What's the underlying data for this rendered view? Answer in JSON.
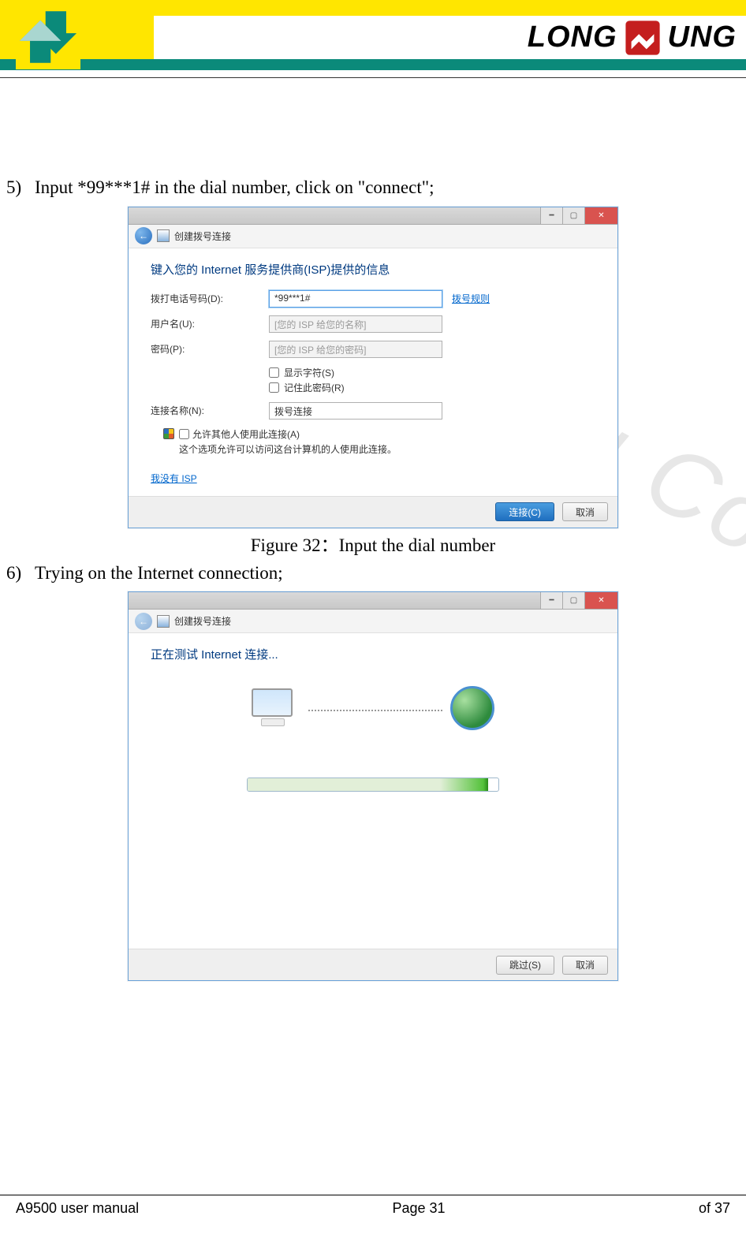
{
  "brand": {
    "name_left": "LONG",
    "name_right": "UNG"
  },
  "watermark": "LongSung Confidential",
  "step5": {
    "num": "5)",
    "text": "Input *99***1# in the dial number, click on \"connect\";"
  },
  "window1": {
    "title": "创建拨号连接",
    "heading": "键入您的 Internet 服务提供商(ISP)提供的信息",
    "labels": {
      "dial": "拨打电话号码(D):",
      "user": "用户名(U):",
      "pass": "密码(P):",
      "conn": "连接名称(N):"
    },
    "values": {
      "dial": "*99***1#",
      "user_ph": "[您的 ISP 给您的名称]",
      "pass_ph": "[您的 ISP 给您的密码]",
      "conn": "拨号连接"
    },
    "dial_rules": "拨号规则",
    "show_chars": "显示字符(S)",
    "remember_pw": "记住此密码(R)",
    "allow_others": "允许其他人使用此连接(A)",
    "allow_desc": "这个选项允许可以访问这台计算机的人使用此连接。",
    "no_isp": "我没有 ISP",
    "connect": "连接(C)",
    "cancel": "取消"
  },
  "caption1": "Figure 32：Input the dial number",
  "step6": {
    "num": "6)",
    "text": "Trying on the Internet connection;"
  },
  "window2": {
    "title": "创建拨号连接",
    "heading": "正在测试 Internet 连接...",
    "skip": "跳过(S)",
    "cancel": "取消"
  },
  "footer": {
    "left": "A9500 user manual",
    "center": "Page 31",
    "right": "of 37"
  }
}
